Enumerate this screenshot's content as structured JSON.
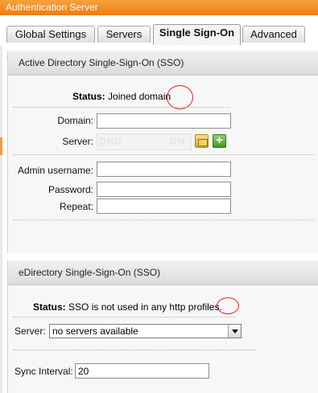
{
  "window": {
    "title": "Authentication Server"
  },
  "tabs": [
    {
      "label": "Global Settings",
      "active": false
    },
    {
      "label": "Servers",
      "active": false
    },
    {
      "label": "Single Sign-On",
      "active": true
    },
    {
      "label": "Advanced",
      "active": false
    }
  ],
  "ad_sso": {
    "title": "Active Directory Single-Sign-On (SSO)",
    "status_label": "Status:",
    "status_value": "Joined domain",
    "domain_label": "Domain:",
    "domain_value": "",
    "server_label": "Server:",
    "server_placeholder_left": "DND",
    "server_placeholder_right": "DN",
    "admin_label": "Admin username:",
    "admin_value": "",
    "password_label": "Password:",
    "password_value": "",
    "repeat_label": "Repeat:",
    "repeat_value": "",
    "folder_icon": "folder-open-icon",
    "add_icon": "add-plus-icon",
    "add_glyph": "+"
  },
  "edir_sso": {
    "title": "eDirectory Single-Sign-On (SSO)",
    "status_label": "Status:",
    "status_value": "SSO is not used in any http profiles.",
    "server_label": "Server:",
    "server_selected": "no servers available",
    "sync_label": "Sync Interval:",
    "sync_value": "20"
  },
  "colors": {
    "title_bar": "#f08a1c",
    "annotation_circle": "#dd2222",
    "add_button": "#4aa82c",
    "folder_button": "#e2bb45"
  }
}
